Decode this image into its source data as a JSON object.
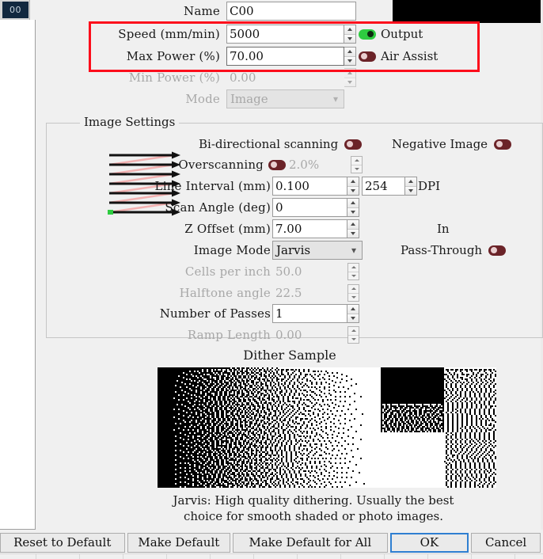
{
  "window": {
    "tab_badge": "00",
    "color_swatch": "#000000",
    "annotation_color": "#fc0d1b"
  },
  "fields": {
    "name": {
      "label": "Name",
      "value": "C00"
    },
    "speed": {
      "label": "Speed (mm/min)",
      "value": "5000"
    },
    "max_power": {
      "label": "Max Power (%)",
      "value": "70.00"
    },
    "min_power": {
      "label": "Min Power (%)",
      "value": "0.00"
    },
    "mode": {
      "label": "Mode",
      "value": "Image"
    }
  },
  "toggles": {
    "output": {
      "label": "Output",
      "state": "on",
      "color": "#2ecc40"
    },
    "air_assist": {
      "label": "Air Assist",
      "state": "off",
      "color": "#6b2328"
    },
    "bidirectional": {
      "label": "Bi-directional scanning",
      "state": "off"
    },
    "negative_image": {
      "label": "Negative Image",
      "state": "off"
    },
    "overscanning": {
      "label": "Overscanning",
      "state": "off",
      "value": "2.0%"
    },
    "pass_through": {
      "label": "Pass-Through",
      "state": "off"
    }
  },
  "image_settings": {
    "group_title": "Image Settings",
    "line_interval": {
      "label": "Line Interval (mm)",
      "value": "0.100"
    },
    "dpi": {
      "label": "DPI",
      "value": "254"
    },
    "scan_angle": {
      "label": "Scan Angle (deg)",
      "value": "0"
    },
    "z_offset": {
      "label": "Z Offset (mm)",
      "value": "7.00"
    },
    "in_label": "In",
    "image_mode": {
      "label": "Image Mode",
      "value": "Jarvis"
    },
    "cells_per_inch": {
      "label": "Cells per inch",
      "value": "50.0"
    },
    "halftone_angle": {
      "label": "Halftone angle",
      "value": "22.5"
    },
    "number_of_passes": {
      "label": "Number of Passes",
      "value": "1"
    },
    "ramp_length": {
      "label": "Ramp Length",
      "value": "0.00"
    }
  },
  "dither": {
    "title": "Dither Sample",
    "description_line1": "Jarvis: High quality dithering. Usually the best",
    "description_line2": "choice for smooth shaded or photo images."
  },
  "buttons": {
    "reset_to_default": "Reset to Default",
    "make_default": "Make Default",
    "make_default_for_all": "Make Default for All",
    "ok": "OK",
    "cancel": "Cancel"
  }
}
